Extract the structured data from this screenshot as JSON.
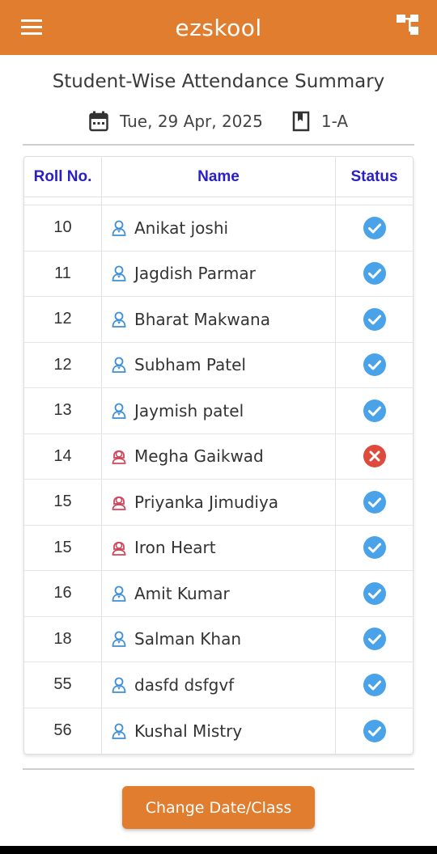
{
  "app": {
    "title": "ezskool",
    "menu_icon": "hamburger-menu-icon",
    "right_icon": "hierarchy-icon"
  },
  "page": {
    "heading": "Student-Wise Attendance Summary",
    "date": "Tue, 29 Apr, 2025",
    "class": "1-A"
  },
  "table": {
    "headers": {
      "roll": "Roll No.",
      "name": "Name",
      "status": "Status"
    },
    "rows": [
      {
        "roll": "10",
        "name": "Anikat joshi",
        "gender": "male",
        "status": "present"
      },
      {
        "roll": "11",
        "name": "Jagdish Parmar",
        "gender": "male",
        "status": "present"
      },
      {
        "roll": "12",
        "name": "Bharat Makwana",
        "gender": "male",
        "status": "present"
      },
      {
        "roll": "12",
        "name": "Subham Patel",
        "gender": "male",
        "status": "present"
      },
      {
        "roll": "13",
        "name": "Jaymish patel",
        "gender": "male",
        "status": "present"
      },
      {
        "roll": "14",
        "name": "Megha Gaikwad",
        "gender": "female",
        "status": "absent"
      },
      {
        "roll": "15",
        "name": "Priyanka Jimudiya",
        "gender": "female",
        "status": "present"
      },
      {
        "roll": "15",
        "name": "Iron Heart",
        "gender": "female",
        "status": "present"
      },
      {
        "roll": "16",
        "name": "Amit Kumar",
        "gender": "male",
        "status": "present"
      },
      {
        "roll": "18",
        "name": "Salman Khan",
        "gender": "male",
        "status": "present"
      },
      {
        "roll": "55",
        "name": "dasfd dsfgvf",
        "gender": "male",
        "status": "present"
      },
      {
        "roll": "56",
        "name": "Kushal Mistry",
        "gender": "male",
        "status": "present"
      }
    ]
  },
  "actions": {
    "change_label": "Change Date/Class"
  },
  "colors": {
    "brand": "#e07d2e",
    "header_text": "#2a1fc4",
    "present": "#4aa3e8",
    "absent": "#de4b3c",
    "male_icon": "#3d8fd8",
    "female_icon": "#d2465a"
  }
}
